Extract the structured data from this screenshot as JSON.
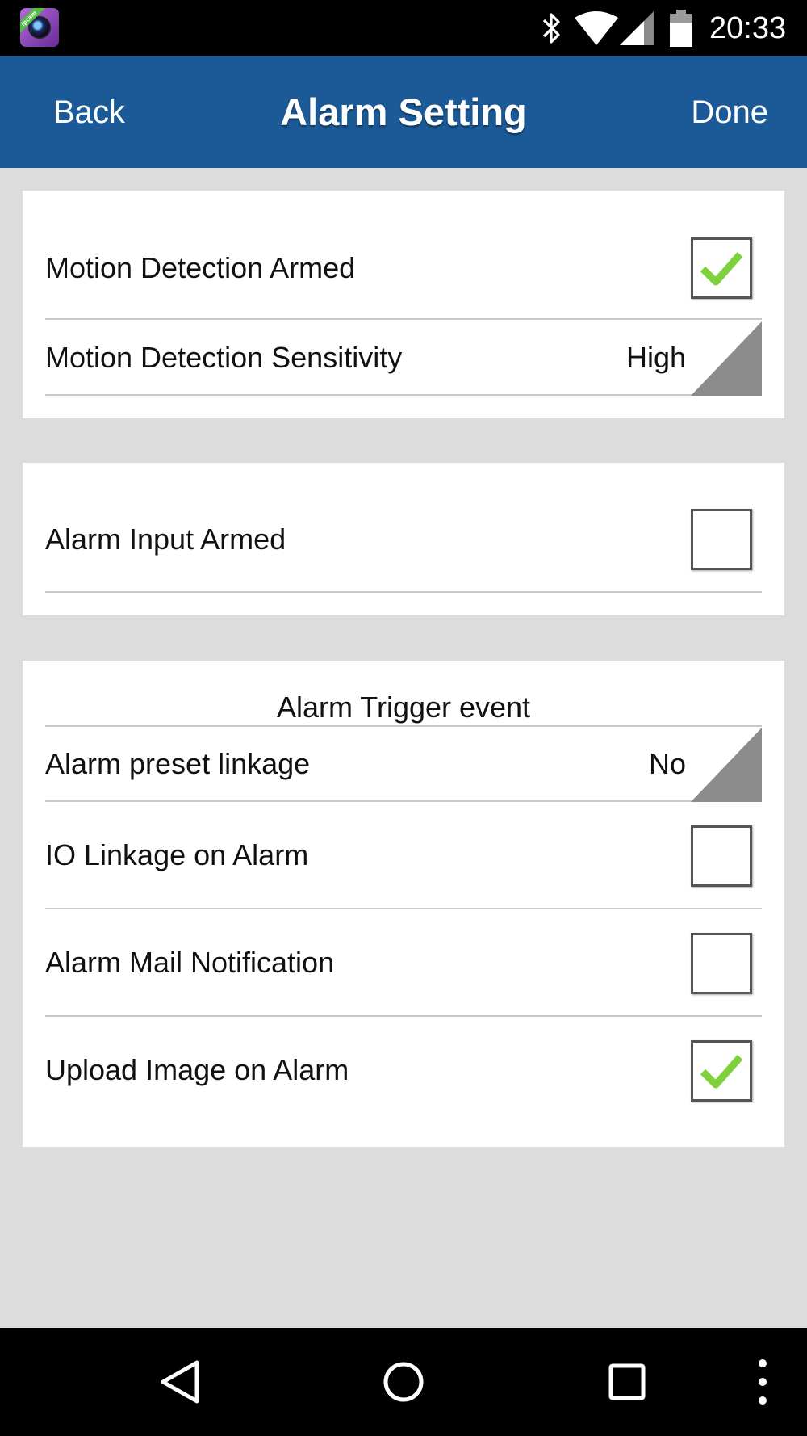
{
  "status_bar": {
    "time": "20:33",
    "app_icon_text": "ipcam",
    "icons": [
      "bluetooth-icon",
      "wifi-icon",
      "signal-icon",
      "battery-icon"
    ]
  },
  "nav": {
    "back_label": "Back",
    "title": "Alarm Setting",
    "done_label": "Done"
  },
  "motion": {
    "armed_label": "Motion Detection Armed",
    "armed_checked": true,
    "sensitivity_label": "Motion Detection Sensitivity",
    "sensitivity_value": "High"
  },
  "alarm_input": {
    "armed_label": "Alarm Input Armed",
    "armed_checked": false
  },
  "trigger": {
    "header": "Alarm Trigger event",
    "preset_label": "Alarm preset linkage",
    "preset_value": "No",
    "io_label": "IO Linkage on Alarm",
    "io_checked": false,
    "mail_label": "Alarm Mail Notification",
    "mail_checked": false,
    "upload_label": "Upload Image on Alarm",
    "upload_checked": true
  },
  "colors": {
    "navbar": "#1b5a97",
    "background": "#dcdcdc",
    "check": "#7fd13b",
    "corner": "#8c8c8c"
  },
  "system_nav": {
    "icons": [
      "back-triangle-icon",
      "home-circle-icon",
      "recents-square-icon",
      "overflow-menu-icon"
    ]
  }
}
